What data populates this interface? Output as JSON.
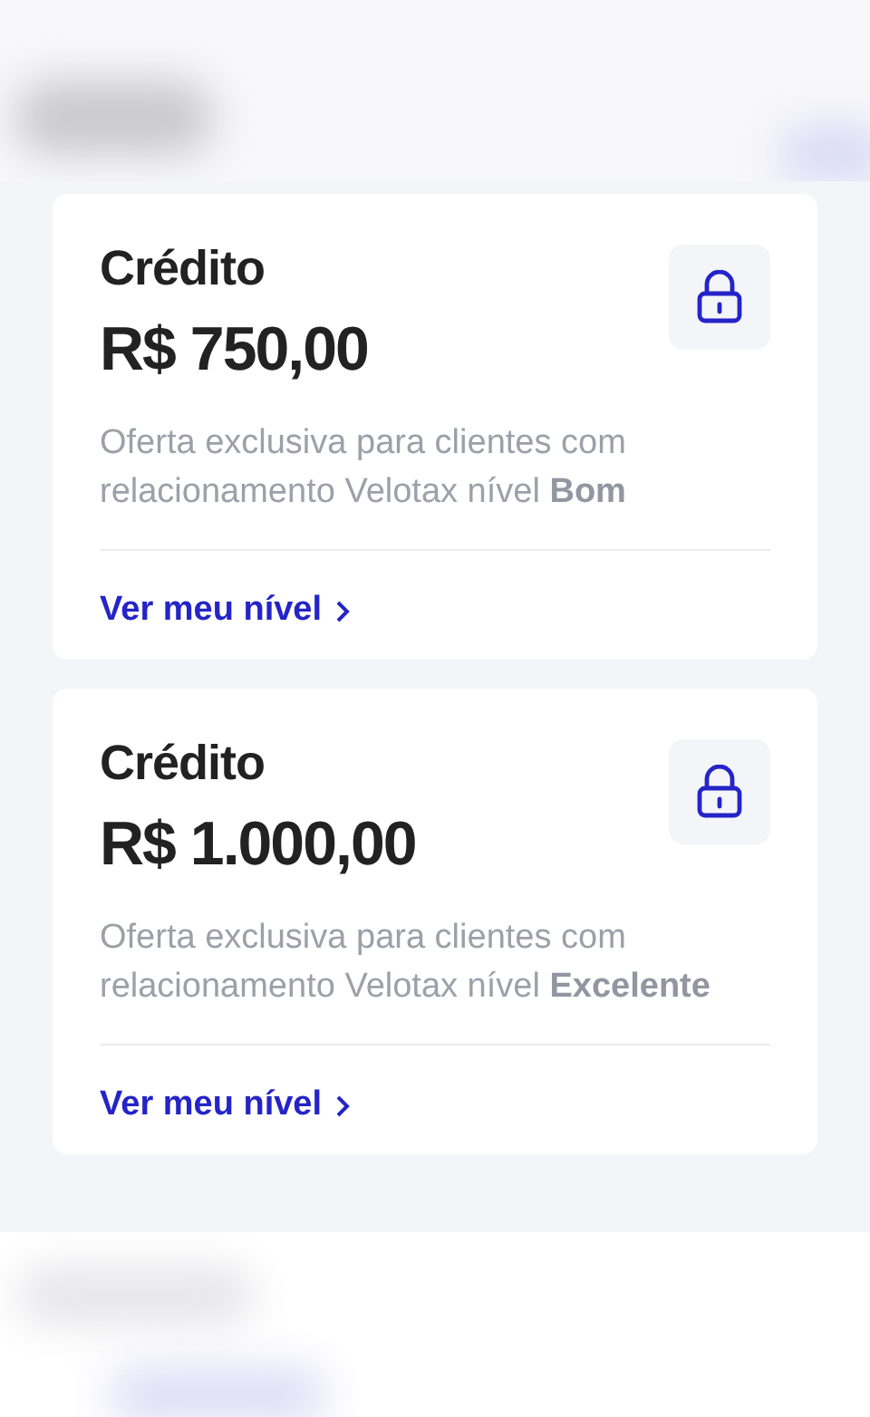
{
  "cards": [
    {
      "title": "Crédito",
      "amount": "R$ 750,00",
      "description": "Oferta exclusiva para clientes com relacionamento Velotax nível **Bom**",
      "link": "Ver meu nível"
    },
    {
      "title": "Crédito",
      "amount": "R$ 1.000,00",
      "description": "Oferta exclusiva para clientes com relacionamento Velotax nível **Excelente**",
      "link": "Ver meu nível"
    }
  ]
}
